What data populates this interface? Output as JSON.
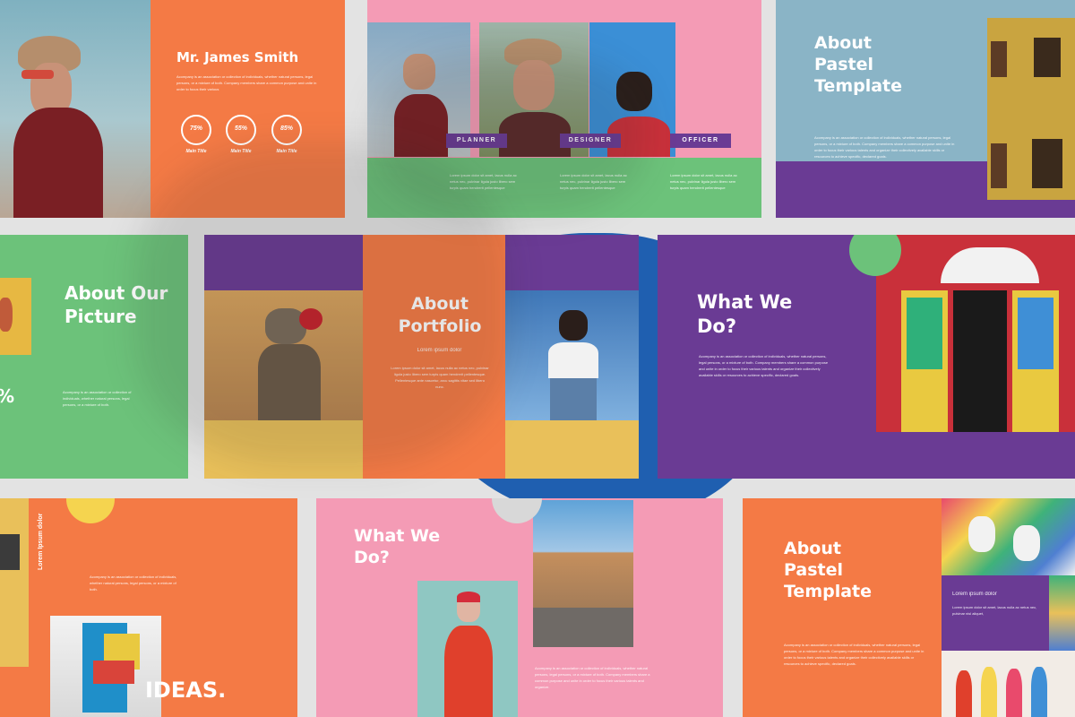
{
  "colors": {
    "orange": "#f47a45",
    "pink": "#f49bb5",
    "green": "#6cc27a",
    "purple": "#6a3b94",
    "blue": "#8ab4c6",
    "yellow": "#e9c05a",
    "royal_blue": "#1f5fb0",
    "canvas": "#e3e3e3"
  },
  "slide1": {
    "name": "Mr. James Smith",
    "body": "Acompany is an association or collection of individuals, whether natural persons, legal persons, or a mixture of both. Company members share a common purpose and unite in order to focus their various",
    "rings": [
      {
        "value": "75%",
        "caption": "Main Title"
      },
      {
        "value": "55%",
        "caption": "Main Title"
      },
      {
        "value": "85%",
        "caption": "Main Title"
      }
    ]
  },
  "slide2": {
    "roles": [
      "PLANNER",
      "DESIGNER",
      "OFFICER"
    ],
    "body": "Lorem ipsum dolor sit amet, lacus nulla ac netus nec, pulvinar ligula justo libero sem turpis quam hendrerit pellentesque"
  },
  "slide3": {
    "title": "About Pastel Template",
    "body": "Acompany is an association or collection of individuals, whether natural persons, legal persons, or a mixture of both. Company members share a common purpose and unite in order to focus their various talents and organize their collectively available skills or resources to achieve specific, declared goals."
  },
  "slide4": {
    "title": "About Our Picture",
    "pct": "%",
    "body": "Acompany is an association or collection of individuals, whether natural persons, legal persons, or a mixture of both."
  },
  "slide5": {
    "title": "About Portfolio",
    "subtitle": "Lorem ipsum dolor",
    "body": "Lorem ipsum dolor sit amet, lacus nulla ac netus nec, pulvinar ligula justo libero sem turpis quam hendrerit pellentesque. Pellentesque ante nascetur, arcu sagittis vitae sed libero nunc."
  },
  "slide6": {
    "title": "What We Do?",
    "body": "Acompany is an association or collection of individuals, whether natural persons, legal persons, or a mixture of both. Company members share a common purpose and unite in order to focus their various talents and organize their collectively available skills or resources to achieve specific, declared goals."
  },
  "slide7": {
    "vertical": "Lorem Ipsum dolor",
    "body": "Acompany is an association or collection of individuals, whether natural persons, legal persons, or a mixture of both.",
    "ideas": "IDEAS."
  },
  "slide8": {
    "title": "What We Do?",
    "body": "Acompany is an association or collection of individuals, whether natural persons, legal persons, or a mixture of both. Company members share a common purpose and unite in order to focus their various talents and organize."
  },
  "slide9": {
    "title": "About Pastel Template",
    "box_title": "Lorem ipsum dolor",
    "box_body": "Lorem ipsum dolor sit amet, lacus nulla ac netus nec, pulvinar nisl aliquet,",
    "body": "Acompany is an association or collection of individuals, whether natural persons, legal persons, or a mixture of both. Company members share a common purpose and unite in order to focus their various talents and organize their collectively available skills or resources to achieve specific, declared goals."
  }
}
